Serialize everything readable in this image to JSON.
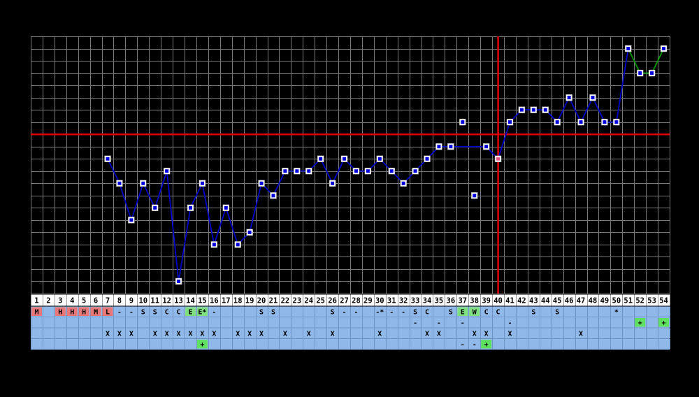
{
  "chart_data": {
    "type": "line",
    "title": "",
    "xlabel": "",
    "ylabel": "",
    "grid": true,
    "days": [
      1,
      2,
      3,
      4,
      5,
      6,
      7,
      8,
      9,
      10,
      11,
      12,
      13,
      14,
      15,
      16,
      17,
      18,
      19,
      20,
      21,
      22,
      23,
      24,
      25,
      26,
      27,
      28,
      29,
      30,
      31,
      32,
      33,
      34,
      35,
      36,
      37,
      38,
      39,
      40,
      41,
      42,
      43,
      44,
      45,
      46,
      47,
      48,
      49,
      50,
      51,
      52,
      53,
      54
    ],
    "series": [
      {
        "color": "#0000cc",
        "points": [
          {
            "day": 7,
            "v": 11
          },
          {
            "day": 8,
            "v": 9
          },
          {
            "day": 9,
            "v": 6
          },
          {
            "day": 10,
            "v": 9
          },
          {
            "day": 11,
            "v": 7
          },
          {
            "day": 12,
            "v": 10
          },
          {
            "day": 13,
            "v": 1
          },
          {
            "day": 14,
            "v": 7
          },
          {
            "day": 15,
            "v": 9
          },
          {
            "day": 16,
            "v": 4
          },
          {
            "day": 17,
            "v": 7
          },
          {
            "day": 18,
            "v": 4
          },
          {
            "day": 19,
            "v": 5
          },
          {
            "day": 20,
            "v": 9
          },
          {
            "day": 21,
            "v": 8
          },
          {
            "day": 22,
            "v": 10
          },
          {
            "day": 23,
            "v": 10
          },
          {
            "day": 24,
            "v": 10
          },
          {
            "day": 25,
            "v": 11
          },
          {
            "day": 26,
            "v": 9
          },
          {
            "day": 27,
            "v": 11
          },
          {
            "day": 28,
            "v": 10
          },
          {
            "day": 29,
            "v": 10
          },
          {
            "day": 30,
            "v": 11
          },
          {
            "day": 31,
            "v": 10
          },
          {
            "day": 32,
            "v": 9
          },
          {
            "day": 33,
            "v": 10
          },
          {
            "day": 34,
            "v": 11
          },
          {
            "day": 35,
            "v": 12
          },
          {
            "day": 36,
            "v": 12
          },
          {
            "day": 39,
            "v": 12
          },
          {
            "day": 40,
            "v": 11
          },
          {
            "day": 41,
            "v": 14
          },
          {
            "day": 42,
            "v": 15
          },
          {
            "day": 43,
            "v": 15
          },
          {
            "day": 44,
            "v": 15
          },
          {
            "day": 45,
            "v": 14
          },
          {
            "day": 46,
            "v": 16
          },
          {
            "day": 47,
            "v": 14
          },
          {
            "day": 48,
            "v": 16
          },
          {
            "day": 49,
            "v": 14
          },
          {
            "day": 50,
            "v": 14
          },
          {
            "day": 51,
            "v": 20
          }
        ]
      },
      {
        "color": "#009900",
        "points": [
          {
            "day": 51,
            "v": 20
          },
          {
            "day": 52,
            "v": 18
          },
          {
            "day": 53,
            "v": 18
          },
          {
            "day": 54,
            "v": 20
          }
        ]
      }
    ],
    "isolated_points": [
      {
        "day": 37,
        "v": 14
      },
      {
        "day": 38,
        "v": 8
      }
    ],
    "highlighted_point": {
      "day": 40,
      "v": 11
    },
    "coverline_value": 13,
    "ovulation_day": 40,
    "y_range": [
      0,
      21
    ],
    "rows": [
      {
        "bg": "#90b8e8",
        "cells": [
          {
            "day": 1,
            "t": "M",
            "c": "#e87878"
          },
          {
            "day": 3,
            "t": "H",
            "c": "#e87878"
          },
          {
            "day": 4,
            "t": "H",
            "c": "#e87878"
          },
          {
            "day": 5,
            "t": "H",
            "c": "#e87878"
          },
          {
            "day": 6,
            "t": "M",
            "c": "#e87878"
          },
          {
            "day": 7,
            "t": "L",
            "c": "#e87878"
          },
          {
            "day": 8,
            "t": "-"
          },
          {
            "day": 9,
            "t": "-"
          },
          {
            "day": 10,
            "t": "S"
          },
          {
            "day": 11,
            "t": "S"
          },
          {
            "day": 12,
            "t": "C"
          },
          {
            "day": 13,
            "t": "C"
          },
          {
            "day": 14,
            "t": "E",
            "c": "#80e080"
          },
          {
            "day": 15,
            "t": "E*",
            "c": "#80e080"
          },
          {
            "day": 16,
            "t": "-"
          },
          {
            "day": 20,
            "t": "S"
          },
          {
            "day": 21,
            "t": "S"
          },
          {
            "day": 26,
            "t": "S"
          },
          {
            "day": 27,
            "t": "-"
          },
          {
            "day": 28,
            "t": "-"
          },
          {
            "day": 30,
            "t": "-*"
          },
          {
            "day": 31,
            "t": "-"
          },
          {
            "day": 32,
            "t": "-"
          },
          {
            "day": 33,
            "t": "S"
          },
          {
            "day": 34,
            "t": "C"
          },
          {
            "day": 36,
            "t": "S"
          },
          {
            "day": 37,
            "t": "E",
            "c": "#80e080"
          },
          {
            "day": 38,
            "t": "W",
            "c": "#80e080"
          },
          {
            "day": 39,
            "t": "C"
          },
          {
            "day": 40,
            "t": "C"
          },
          {
            "day": 43,
            "t": "S"
          },
          {
            "day": 45,
            "t": "S"
          },
          {
            "day": 50,
            "t": "*"
          }
        ]
      },
      {
        "bg": "#90b8e8",
        "cells": [
          {
            "day": 33,
            "t": "-"
          },
          {
            "day": 35,
            "t": "-"
          },
          {
            "day": 37,
            "t": "-"
          },
          {
            "day": 41,
            "t": "-"
          },
          {
            "day": 52,
            "t": "+",
            "c": "#60e060"
          },
          {
            "day": 54,
            "t": "+",
            "c": "#60e060"
          }
        ]
      },
      {
        "bg": "#90b8e8",
        "cells": [
          {
            "day": 7,
            "t": "X"
          },
          {
            "day": 8,
            "t": "X"
          },
          {
            "day": 9,
            "t": "X"
          },
          {
            "day": 11,
            "t": "X"
          },
          {
            "day": 12,
            "t": "X"
          },
          {
            "day": 13,
            "t": "X"
          },
          {
            "day": 14,
            "t": "X"
          },
          {
            "day": 15,
            "t": "X"
          },
          {
            "day": 16,
            "t": "X"
          },
          {
            "day": 18,
            "t": "X"
          },
          {
            "day": 19,
            "t": "X"
          },
          {
            "day": 20,
            "t": "X"
          },
          {
            "day": 22,
            "t": "X"
          },
          {
            "day": 24,
            "t": "X"
          },
          {
            "day": 26,
            "t": "X"
          },
          {
            "day": 30,
            "t": "X"
          },
          {
            "day": 34,
            "t": "X"
          },
          {
            "day": 35,
            "t": "X"
          },
          {
            "day": 38,
            "t": "X"
          },
          {
            "day": 39,
            "t": "X"
          },
          {
            "day": 41,
            "t": "X"
          },
          {
            "day": 47,
            "t": "X"
          }
        ]
      },
      {
        "bg": "#90b8e8",
        "cells": [
          {
            "day": 15,
            "t": "+",
            "c": "#60e060"
          },
          {
            "day": 37,
            "t": "-"
          },
          {
            "day": 38,
            "t": "-"
          },
          {
            "day": 39,
            "t": "+",
            "c": "#60e060"
          }
        ]
      }
    ]
  }
}
